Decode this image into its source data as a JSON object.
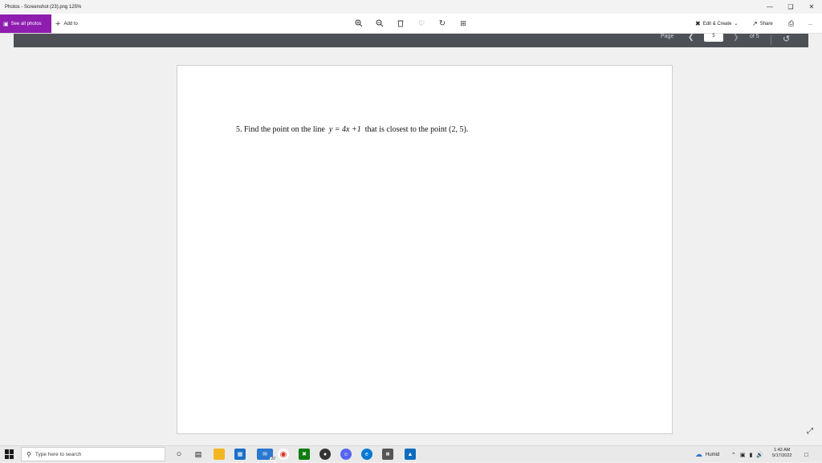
{
  "window": {
    "title": "Photos - Screenshot (23).png  125%",
    "minimize_icon": "minimize-icon",
    "maximize_icon": "restore-icon",
    "close_icon": "close-icon"
  },
  "toolbar": {
    "see_all_photos": "See all photos",
    "add_to": "Add to",
    "edit_create": "Edit & Create",
    "share": "Share",
    "more": "...",
    "icons": [
      "zoom-in-icon",
      "zoom-out-icon",
      "delete-icon",
      "heart-icon",
      "rotate-icon",
      "crop-icon",
      "print-icon"
    ]
  },
  "pagebar": {
    "page_label": "Page",
    "current_page": "5",
    "of_label": "of 5"
  },
  "document": {
    "problem_prefix": "5. Find the point on the line",
    "equation": "y = 4x +1",
    "problem_middle": "that is closest to the point",
    "point": "(2, 5)."
  },
  "taskbar": {
    "search_placeholder": "Type here to search",
    "mail_badge": "20",
    "weather": "Humid",
    "time": "1:42 AM",
    "date": "5/17/2022"
  },
  "colors": {
    "accent": "#8e1db0",
    "pagebar": "#4d5156"
  }
}
